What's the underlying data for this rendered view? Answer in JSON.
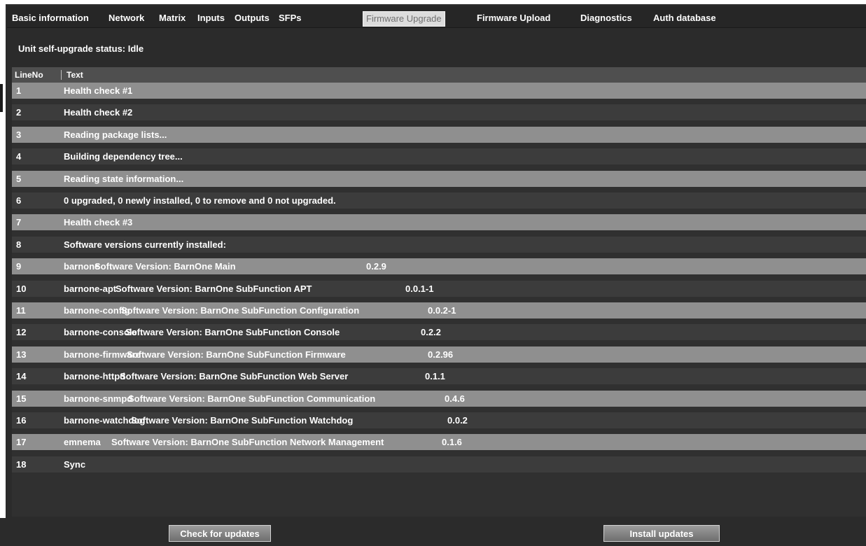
{
  "tabs": [
    {
      "label": "Basic information"
    },
    {
      "label": "Network"
    },
    {
      "label": "Matrix"
    },
    {
      "label": "Inputs"
    },
    {
      "label": "Outputs"
    },
    {
      "label": "SFPs"
    },
    {
      "label": "Firmware Upgrade",
      "active": true
    },
    {
      "label": "Firmware Upload"
    },
    {
      "label": "Diagnostics"
    },
    {
      "label": "Auth database"
    }
  ],
  "status": "Unit self-upgrade status: Idle",
  "grid": {
    "columns": [
      "LineNo",
      "Text"
    ],
    "rows": [
      {
        "no": "1",
        "text": "Health check #1"
      },
      {
        "no": "2",
        "text": "Health check #2"
      },
      {
        "no": "3",
        "text": "Reading package lists..."
      },
      {
        "no": "4",
        "text": "Building dependency tree..."
      },
      {
        "no": "5",
        "text": "Reading state information..."
      },
      {
        "no": "6",
        "text": "0 upgraded, 0 newly installed, 0 to remove and 0 not upgraded."
      },
      {
        "no": "7",
        "text": "Health check #3"
      },
      {
        "no": "8",
        "text": "Software versions currently installed:"
      },
      {
        "no": "9",
        "pkg": "barnone",
        "desc": "Software Version: BarnOne Main",
        "ver": "0.2.9"
      },
      {
        "no": "10",
        "pkg": "barnone-apt",
        "desc": "Software Version: BarnOne SubFunction APT",
        "ver": "0.0.1-1"
      },
      {
        "no": "11",
        "pkg": "barnone-config",
        "desc": "Software Version: BarnOne SubFunction Configuration",
        "ver": "0.0.2-1"
      },
      {
        "no": "12",
        "pkg": "barnone-console",
        "desc": "Software Version: BarnOne SubFunction Console",
        "ver": "0.2.2"
      },
      {
        "no": "13",
        "pkg": "barnone-firmware",
        "desc": "Software Version: BarnOne SubFunction Firmware",
        "ver": "0.2.96"
      },
      {
        "no": "14",
        "pkg": "barnone-httpd",
        "desc": "Software Version: BarnOne SubFunction Web Server",
        "ver": "0.1.1"
      },
      {
        "no": "15",
        "pkg": "barnone-snmpd",
        "desc": "Software Version: BarnOne SubFunction Communication",
        "ver": "0.4.6"
      },
      {
        "no": "16",
        "pkg": "barnone-watchdog",
        "desc": "Software Version: BarnOne SubFunction Watchdog",
        "ver": "0.0.2"
      },
      {
        "no": "17",
        "pkg": "emnema",
        "desc": "Software Version: BarnOne SubFunction Network Management",
        "ver": "0.1.6"
      },
      {
        "no": "18",
        "text": "Sync"
      }
    ]
  },
  "buttons": {
    "check": "Check for updates",
    "install": "Install updates"
  }
}
